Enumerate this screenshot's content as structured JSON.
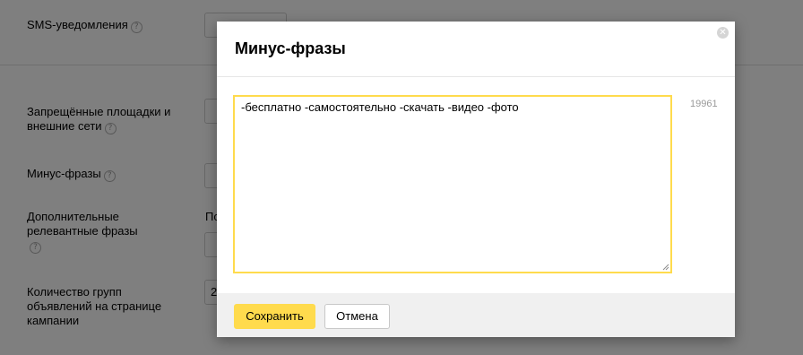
{
  "background": {
    "settings": [
      {
        "label": "SMS-уведомления"
      },
      {
        "label": "Запрещённые площадки и внешние сети"
      },
      {
        "label": "Минус-фразы"
      },
      {
        "label": "Дополнительные релевантные фразы"
      },
      {
        "label": "Количество групп объявлений на странице кампании"
      }
    ],
    "additional_phrases_value_fragment": "По",
    "groups_count_value_fragment": "2"
  },
  "modal": {
    "title": "Минус-фразы",
    "close_icon": "close-icon",
    "textarea_value": "-бесплатно -самостоятельно -скачать -видео -фото",
    "char_counter": "19961",
    "save_label": "Сохранить",
    "cancel_label": "Отмена"
  },
  "colors": {
    "accent": "#ffdb4d",
    "overlay": "rgba(0,0,0,0.5)",
    "footer_bg": "#f0f0f0"
  }
}
